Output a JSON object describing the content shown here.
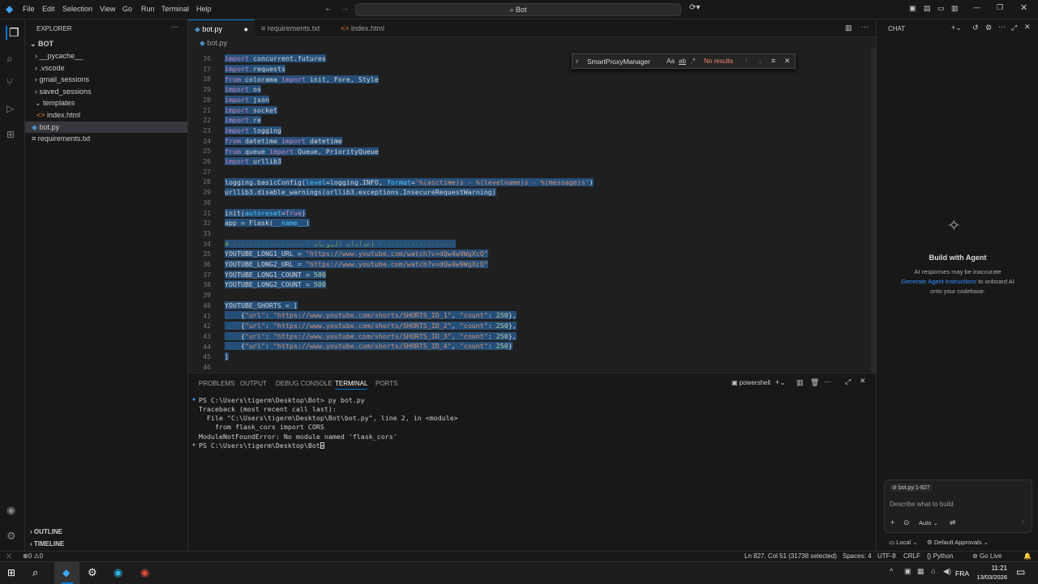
{
  "menu": [
    "File",
    "Edit",
    "Selection",
    "View",
    "Go",
    "Run",
    "Terminal",
    "Help"
  ],
  "search_value": "Bot",
  "activity": [
    "explorer-icon",
    "search-icon",
    "source-control-icon",
    "run-debug-icon",
    "extensions-icon"
  ],
  "explorer": {
    "title": "EXPLORER",
    "root": "BOT",
    "items": [
      "__pycache__",
      ".vscode",
      "gmail_sessions",
      "saved_sessions",
      "templates",
      "index.html",
      "bot.py",
      "requirements.txt"
    ],
    "outline": "OUTLINE",
    "timeline": "TIMELINE"
  },
  "tabs": [
    "bot.py",
    "requirements.txt",
    "index.html"
  ],
  "breadcrumb": "bot.py",
  "find": {
    "value": "SmartProxyManager",
    "aa": "Aa",
    "ab": "ab",
    "re": ".*",
    "result": "No results"
  },
  "line_numbers": [
    "16",
    "17",
    "18",
    "19",
    "20",
    "21",
    "22",
    "23",
    "24",
    "25",
    "26",
    "27",
    "28",
    "29",
    "30",
    "31",
    "32",
    "33",
    "34",
    "35",
    "36",
    "37",
    "38",
    "39",
    "40",
    "41",
    "42",
    "43",
    "44",
    "45",
    "46"
  ],
  "code": {
    "l16": [
      "import",
      "concurrent.futures"
    ],
    "l17": [
      "import",
      "requests"
    ],
    "l18": [
      "from",
      "colorama",
      "import",
      "init, Fore, Style"
    ],
    "l19": [
      "import",
      "os"
    ],
    "l20": [
      "import",
      "json"
    ],
    "l21": [
      "import",
      "socket"
    ],
    "l22": [
      "import",
      "re"
    ],
    "l23": [
      "import",
      "logging"
    ],
    "l24": [
      "from",
      "datetime",
      "import",
      "datetime"
    ],
    "l25": [
      "from",
      "queue",
      "import",
      "Queue, PriorityQueue"
    ],
    "l26": [
      "import",
      "urllib3"
    ],
    "l28": [
      "logging.basicConfig(",
      "level",
      "=logging.INFO, ",
      "format",
      "=",
      "'%(asctime)s - %(levelname)s - %(message)s'",
      ")"
    ],
    "l29": "urllib3.disable_warnings(urllib3.exceptions.InsecureRequestWarning)",
    "l31": [
      "init(",
      "autoreset",
      "=",
      "True",
      ")"
    ],
    "l32": [
      "app = Flask(",
      "__name__",
      ")"
    ],
    "l34": "# ------------------- إعدادات البوتات -------------------",
    "l35": [
      "YOUTUBE_LONG1_URL = ",
      "\"https://www.youtube.com/watch?v=dQw4w9WgXcQ\""
    ],
    "l36": [
      "YOUTUBE_LONG2_URL = ",
      "\"https://www.youtube.com/watch?v=dQw4w9WgXcQ\""
    ],
    "l37": [
      "YOUTUBE_LONG1_COUNT = ",
      "500"
    ],
    "l38": [
      "YOUTUBE_LONG2_COUNT = ",
      "500"
    ],
    "l40": "YOUTUBE_SHORTS = [",
    "l41": [
      "    {",
      "\"url\"",
      ": ",
      "\"https://www.youtube.com/shorts/SHORTS_ID_1\"",
      ", ",
      "\"count\"",
      ": ",
      "250",
      "},"
    ],
    "l42": [
      "    {",
      "\"url\"",
      ": ",
      "\"https://www.youtube.com/shorts/SHORTS_ID_2\"",
      ", ",
      "\"count\"",
      ": ",
      "250",
      "},"
    ],
    "l43": [
      "    {",
      "\"url\"",
      ": ",
      "\"https://www.youtube.com/shorts/SHORTS_ID_3\"",
      ", ",
      "\"count\"",
      ": ",
      "250",
      "},"
    ],
    "l44": [
      "    {",
      "\"url\"",
      ": ",
      "\"https://www.youtube.com/shorts/SHORTS_ID_4\"",
      ", ",
      "\"count\"",
      ": ",
      "250",
      "}"
    ],
    "l45": "]"
  },
  "panel": {
    "tabs": [
      "PROBLEMS",
      "OUTPUT",
      "DEBUG CONSOLE",
      "TERMINAL",
      "PORTS"
    ],
    "shell": "powershell",
    "lines": [
      "PS C:\\Users\\tigerm\\Desktop\\Bot> py bot.py",
      "Traceback (most recent call last):",
      "  File \"C:\\Users\\tigerm\\Desktop\\Bot\\bot.py\", line 2, in <module>",
      "    from flask_cors import CORS",
      "ModuleNotFoundError: No module named 'flask_cors'",
      "PS C:\\Users\\tigerm\\Desktop\\Bot> "
    ]
  },
  "chat": {
    "title": "CHAT",
    "heading": "Build with Agent",
    "line1": "AI responses may be inaccurate",
    "link": "Generate Agent Instructions",
    "line2": " to onboard AI",
    "line3": "onto your codebase.",
    "context": "bot.py:1-827",
    "placeholder": "Describe what to build",
    "mode": "Auto",
    "local": "Local",
    "approvals": "Default Approvals"
  },
  "status": {
    "errors": "0",
    "warnings": "0",
    "position": "Ln 827, Col 51 (31738 selected)",
    "spaces": "Spaces: 4",
    "encoding": "UTF-8",
    "eol": "CRLF",
    "language": "Python",
    "golive": "Go Live"
  },
  "taskbar": {
    "lang": "FRA",
    "time": "11:21",
    "date": "13/03/2026"
  },
  "colors": {
    "accent": "#0078d4",
    "selection": "#264f78",
    "keyword": "#c586c0",
    "string": "#ce9178",
    "comment": "#6a9955"
  }
}
